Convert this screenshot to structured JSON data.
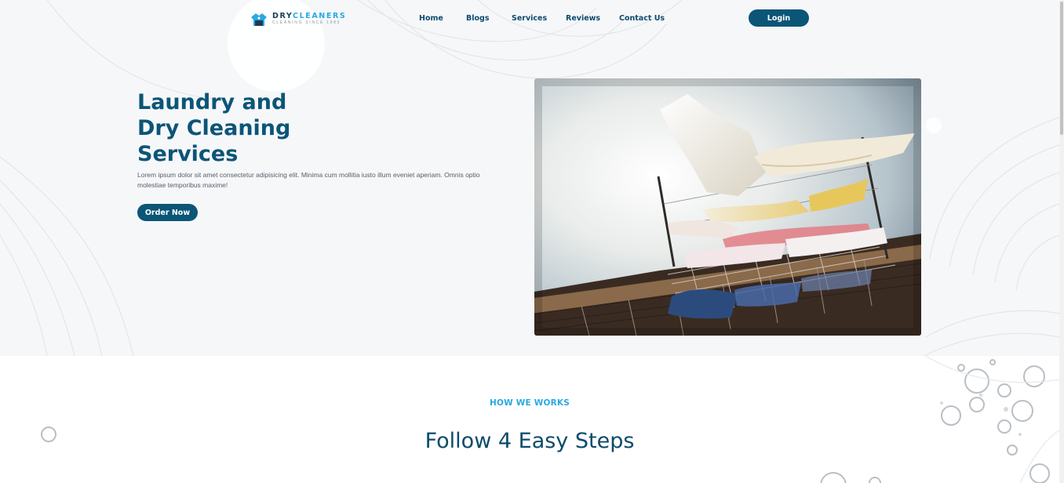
{
  "header": {
    "logo": {
      "name_part1": "DRY",
      "name_part2": "CLEANERS",
      "tagline": "CLEANING SINCE 1985"
    },
    "nav": [
      {
        "label": "Home"
      },
      {
        "label": "Blogs"
      },
      {
        "label": "Services"
      },
      {
        "label": "Reviews"
      },
      {
        "label": "Contact Us"
      }
    ],
    "login_label": "Login"
  },
  "hero": {
    "title_lines": [
      "Laundry and",
      "Dry Cleaning",
      "Services"
    ],
    "description": "Lorem ipsum dolor sit amet consectetur adipisicing elit. Minima cum mollitia iusto illum eveniet aperiam. Omnis optio molestiae temporibus maxime!",
    "cta_label": "Order Now",
    "image_icon": "laundry-clothesline-photo"
  },
  "how_it_works": {
    "eyebrow": "HOW WE WORKS",
    "title": "Follow 4 Easy Steps"
  },
  "colors": {
    "primary": "#0b5577",
    "accent": "#29a9e1",
    "hero_bg": "#f6f7f9"
  }
}
